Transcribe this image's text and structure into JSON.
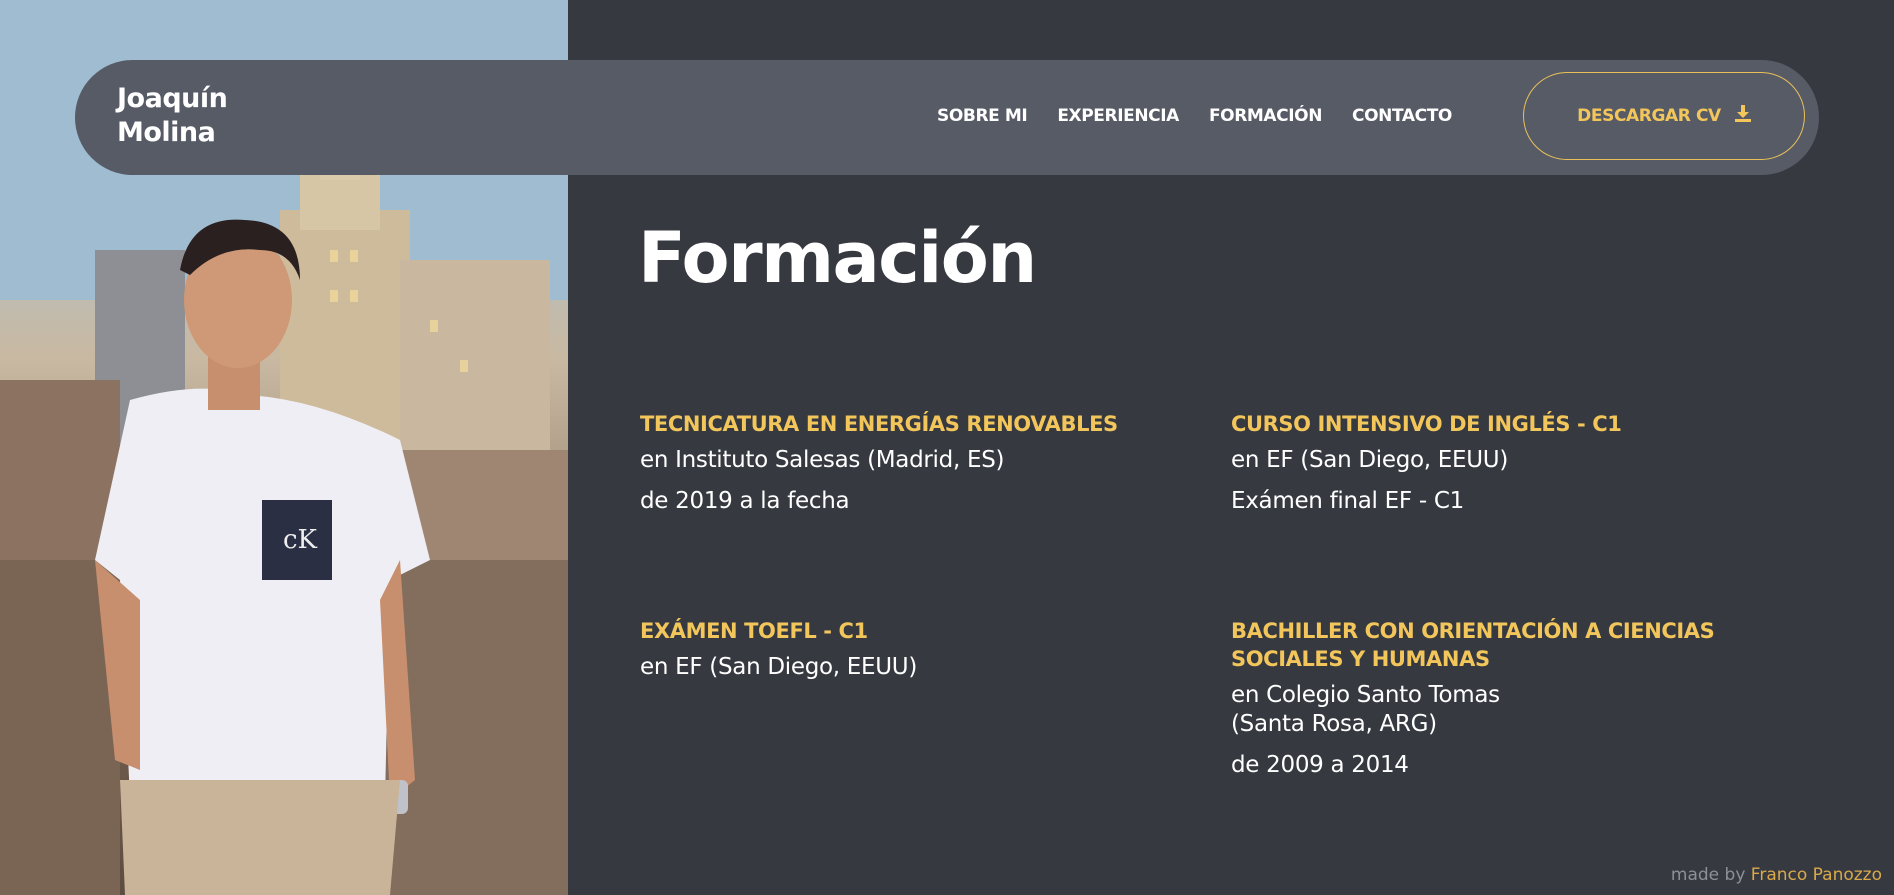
{
  "brand": {
    "line1": "Joaquín",
    "line2": "Molina"
  },
  "nav": {
    "items": [
      {
        "label": "SOBRE MI"
      },
      {
        "label": "EXPERIENCIA"
      },
      {
        "label": "FORMACIÓN"
      },
      {
        "label": "CONTACTO"
      }
    ],
    "cv_button": {
      "label": "DESCARGAR CV",
      "icon": "download-icon"
    }
  },
  "section": {
    "title": "Formación",
    "entries": [
      {
        "title": "TECNICATURA EN ENERGÍAS RENOVABLES",
        "lines": [
          "en Instituto Salesas (Madrid, ES)",
          "de 2019 a la fecha"
        ]
      },
      {
        "title": "CURSO INTENSIVO DE INGLÉS - C1",
        "lines": [
          "en EF (San Diego, EEUU)",
          "Exámen final EF - C1"
        ]
      },
      {
        "title": "EXÁMEN TOEFL - C1",
        "lines": [
          "en EF (San Diego, EEUU)"
        ]
      },
      {
        "title": "BACHILLER CON ORIENTACIÓN A CIENCIAS SOCIALES Y HUMANAS",
        "lines": [
          "en Colegio Santo Tomas",
          "(Santa Rosa, ARG)",
          "de 2009 a 2014"
        ]
      }
    ]
  },
  "footer": {
    "prefix": "made by",
    "author": "Franco Panozzo"
  },
  "colors": {
    "background": "#363940",
    "navbar": "#575b66",
    "accent": "#f3c65b",
    "text": "#ffffff"
  }
}
